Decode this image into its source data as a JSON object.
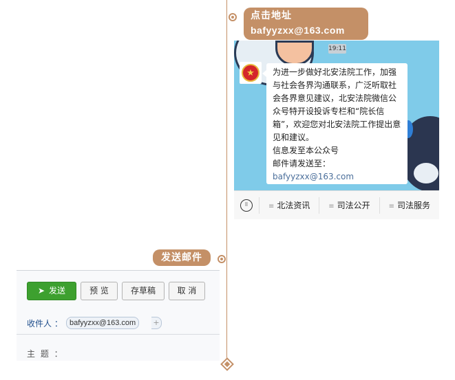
{
  "top_note": {
    "line1": "点击地址",
    "line2": "bafyyzxx@163.com"
  },
  "send_note": "发送邮件",
  "phone": {
    "time": "19:11",
    "message_main": "为进一步做好北安法院工作，加强与社会各界沟通联系，广泛听取社会各界意见建议，北安法院微信公众号特开设投诉专栏和“院长信箱”，欢迎您对北安法院工作提出意见和建议。",
    "message_line2": "信息发至本公众号",
    "message_mail_prefix": "邮件请发送至：",
    "message_mail": "bafyyzxx@163.com",
    "menu": [
      "北法资讯",
      "司法公开",
      "司法服务"
    ]
  },
  "mail_form": {
    "send": "发送",
    "preview": "预 览",
    "draft": "存草稿",
    "cancel": "取 消",
    "to_label": "收件人 ：",
    "to_value": "bafyyzxx@163.com",
    "plus": "+",
    "subject_label": "主 题 ："
  },
  "colors": {
    "accent": "#c49067",
    "send_button": "#3da02f",
    "chat_bg": "#7fcbe9",
    "link": "#4a6e9a"
  }
}
